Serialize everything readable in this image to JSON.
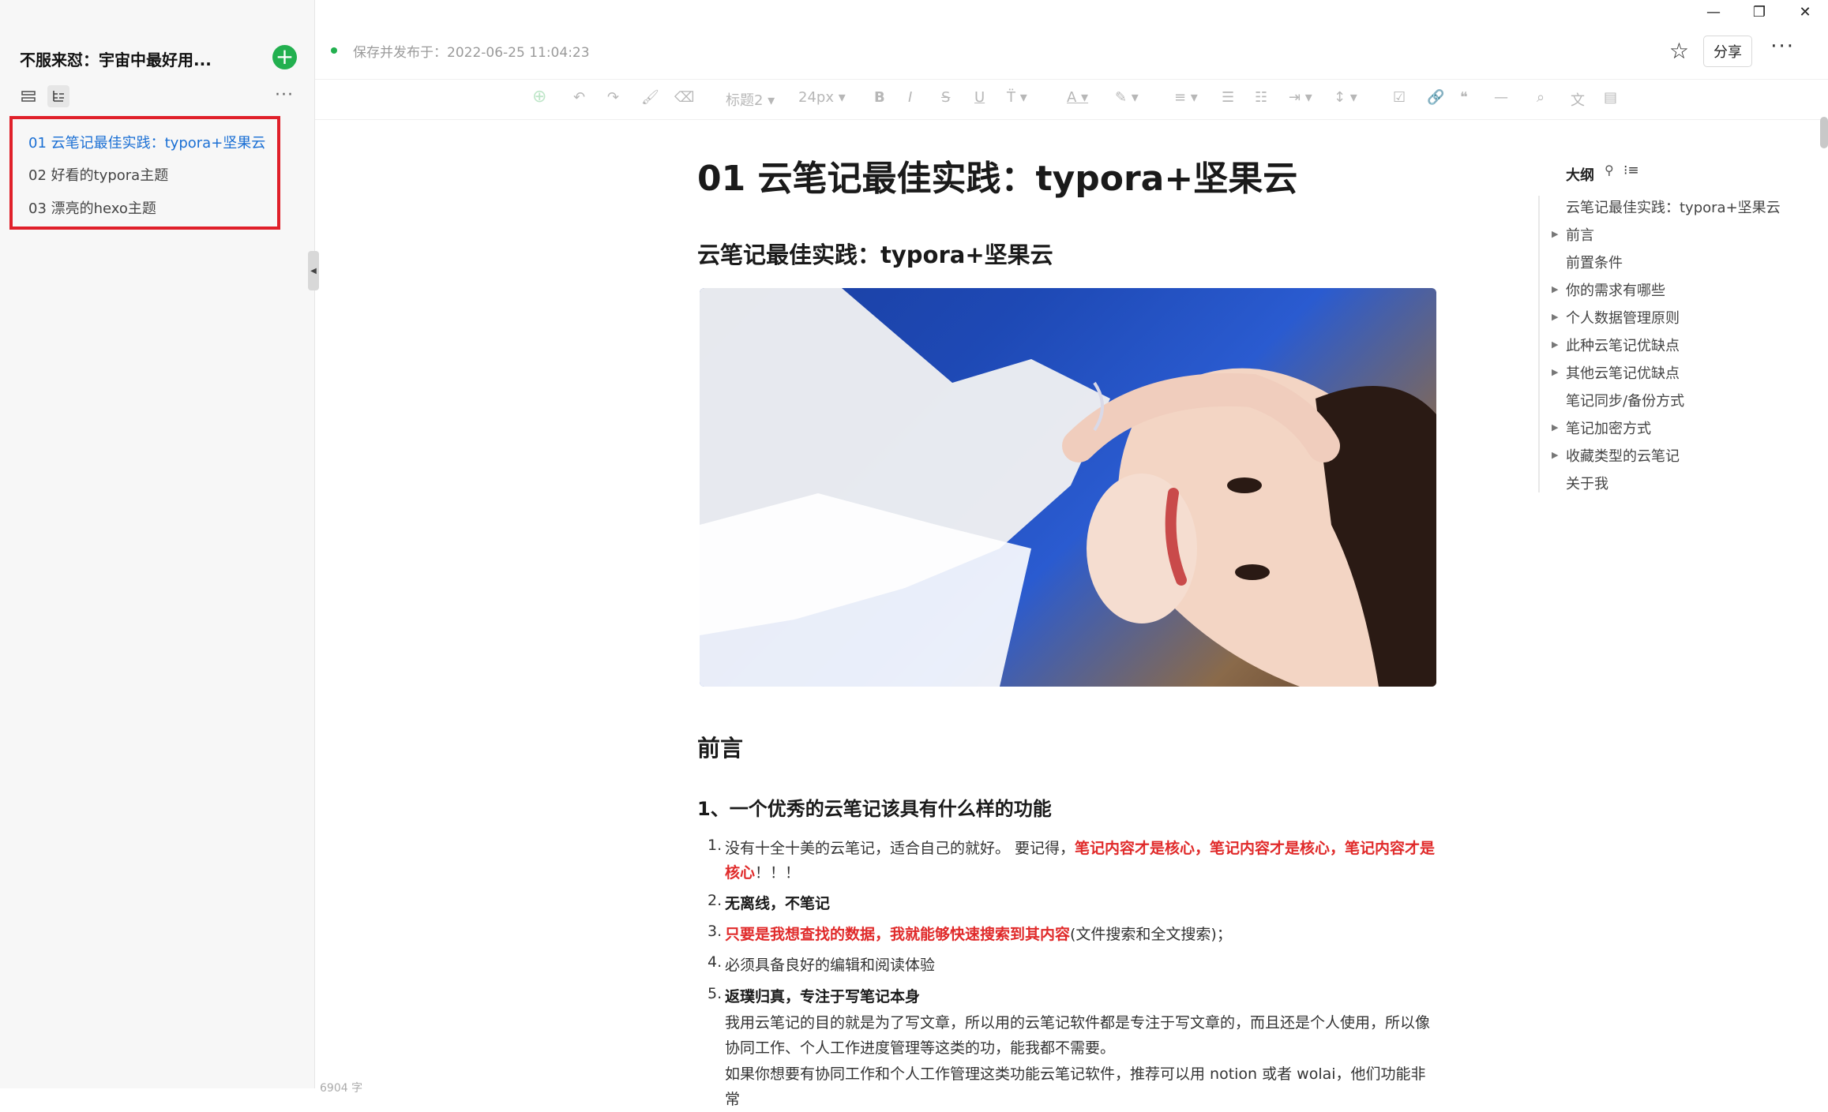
{
  "window": {
    "minimize": "—",
    "restore": "❐",
    "close": "✕"
  },
  "sidebar": {
    "kb_title": "不服来怼：宇宙中最好用...",
    "add_label": "+",
    "docs": [
      {
        "label": "01 云笔记最佳实践：typora+坚果云",
        "active": true
      },
      {
        "label": "02 好看的typora主题"
      },
      {
        "label": "03 漂亮的hexo主题"
      }
    ],
    "more": "···"
  },
  "header": {
    "save_status": "保存并发布于：2022-06-25 11:04:23",
    "share_label": "分享",
    "more": "···"
  },
  "toolbar": {
    "heading_select": "标题2",
    "font_size": "24px"
  },
  "document": {
    "title": "01 云笔记最佳实践：typora+坚果云",
    "h2_first": "云笔记最佳实践：typora+坚果云",
    "h2_preface": "前言",
    "h3_q1": "1、一个优秀的云笔记该具有什么样的功能",
    "list": [
      {
        "num": "1.",
        "pre": "没有十全十美的云笔记，适合自己的就好。  要记得，",
        "red": "笔记内容才是核心，笔记内容才是核心，笔记内容才是核心",
        "post": "！！！"
      },
      {
        "num": "2.",
        "bold": "无离线，不笔记"
      },
      {
        "num": "3.",
        "red": "只要是我想查找的数据，我就能够快速搜索到其内容",
        "post": "(文件搜索和全文搜索)；"
      },
      {
        "num": "4.",
        "text": "必须具备良好的编辑和阅读体验"
      },
      {
        "num": "5.",
        "bold": "返璞归真，专注于写笔记本身"
      }
    ],
    "para1": "我用云笔记的目的就是为了写文章，所以用的云笔记软件都是专注于写文章的，而且还是个人使用，所以像协同工作、个人工作进度管理等这类的功，能我都不需要。",
    "para2": "如果你想要有协同工作和个人工作管理这类功能云笔记软件，推荐可以用 notion 或者 wolai，他们功能非常",
    "word_count": "6904 字"
  },
  "outline": {
    "title": "大纲",
    "items": [
      {
        "label": "云笔记最佳实践：typora+坚果云",
        "caret": false
      },
      {
        "label": "前言",
        "caret": true
      },
      {
        "label": "前置条件",
        "caret": false
      },
      {
        "label": "你的需求有哪些",
        "caret": true
      },
      {
        "label": "个人数据管理原则",
        "caret": true
      },
      {
        "label": "此种云笔记优缺点",
        "caret": true
      },
      {
        "label": "其他云笔记优缺点",
        "caret": true
      },
      {
        "label": "笔记同步/备份方式",
        "caret": false
      },
      {
        "label": "笔记加密方式",
        "caret": true
      },
      {
        "label": "收藏类型的云笔记",
        "caret": true
      },
      {
        "label": "关于我",
        "caret": false
      }
    ]
  },
  "colors": {
    "accent_green": "#22b04f",
    "link_blue": "#1a6fd4",
    "highlight_red": "#e02a2a"
  }
}
